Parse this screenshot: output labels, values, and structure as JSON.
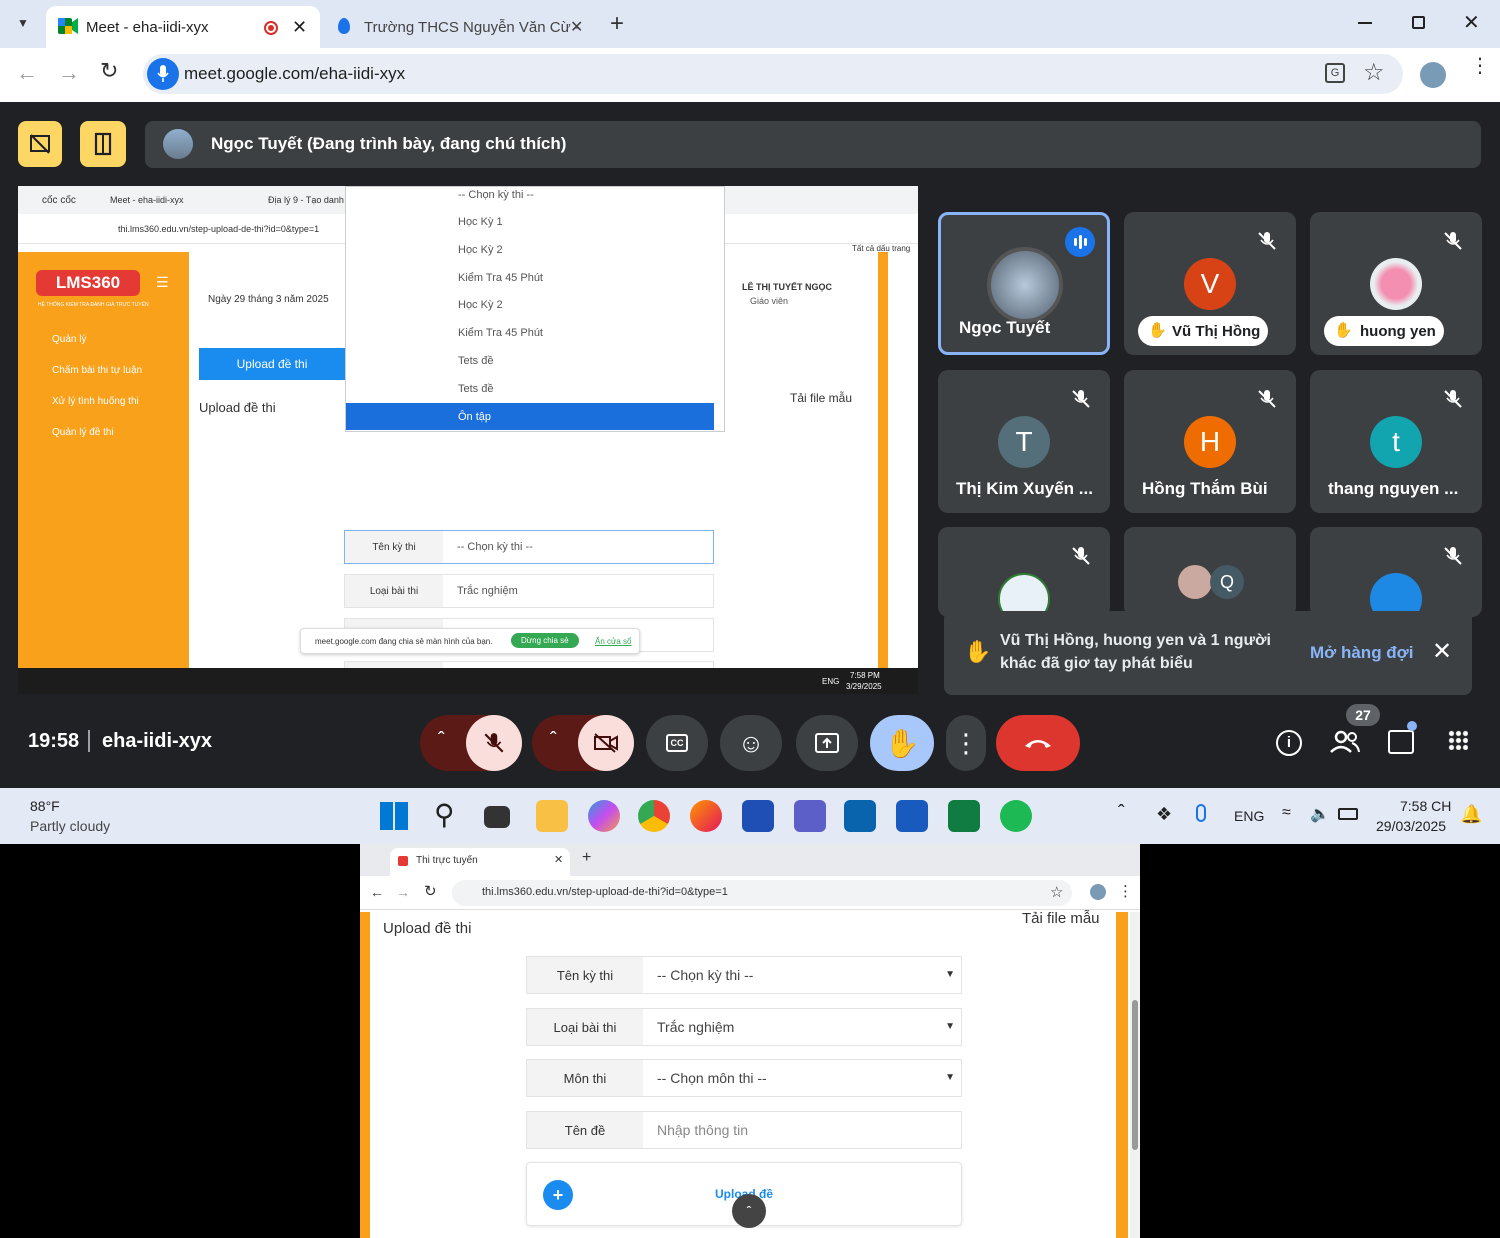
{
  "chrome": {
    "tab1_title": "Meet - eha-iidi-xyx",
    "tab2_title": "Trường THCS Nguyễn Văn Cừ -",
    "url": "meet.google.com/eha-iidi-xyx"
  },
  "meet": {
    "presenter_label": "Ngọc Tuyết (Đang trình bày, đang chú thích)",
    "participants": [
      {
        "name": "Ngọc Tuyết",
        "initial": ""
      },
      {
        "name": "Vũ Thị Hồng",
        "initial": "V"
      },
      {
        "name": "huong yen",
        "initial": ""
      },
      {
        "name": "Thị Kim Xuyến ...",
        "initial": "T"
      },
      {
        "name": "Hồng Thắm Bùi",
        "initial": "H"
      },
      {
        "name": "thang nguyen ...",
        "initial": "t"
      },
      {
        "name": "",
        "initial": ""
      },
      {
        "name": "",
        "initial": "Q"
      },
      {
        "name": "",
        "initial": ""
      }
    ],
    "toast_text": "Vũ Thị Hồng, huong yen và 1 người khác đã giơ tay phát biểu",
    "toast_action": "Mở hàng đợi",
    "time": "19:58",
    "meeting_code": "eha-iidi-xyx",
    "people_count": "27"
  },
  "shared": {
    "browser_tab1": "cốc cốc",
    "browser_tab2": "Meet - eha-iidi-xyx",
    "browser_tab3": "Địa lý 9 - Tạo danh s",
    "url": "thi.lms360.edu.vn/step-upload-de-thi?id=0&type=1",
    "bookmarks": "Tất cả dấu trang",
    "logo": "LMS360",
    "logo_sub": "HỆ THỐNG KIỂM TRA ĐÁNH GIÁ TRỰC TUYẾN",
    "menu": [
      "Quản lý",
      "Chấm bài thi tự luận",
      "Xử lý tình huống thi",
      "Quản lý đề thi"
    ],
    "date": "Ngày 29 tháng 3 năm 2025",
    "user_name": "LÊ THỊ TUYẾT NGỌC",
    "user_role": "Giáo viên",
    "upload_btn": "Upload đề thi",
    "upload_heading": "Upload đề thi",
    "template_link": "Tải file mẫu",
    "dropdown": [
      "-- Chọn kỳ thi --",
      "Học Kỳ 1",
      "Học Kỳ 2",
      "Kiểm Tra 45 Phút",
      "Học Kỳ 2",
      "Kiểm Tra 45 Phút",
      "Tets đề",
      "Tets đề",
      "Ôn tập"
    ],
    "rows": [
      {
        "label": "Tên kỳ thi",
        "value": "-- Chọn kỳ thi --"
      },
      {
        "label": "Loại bài thi",
        "value": "Trắc nghiệm"
      },
      {
        "label": "Môn thi",
        "value": "-- Chọn môn thi --"
      },
      {
        "label": "Tên đề",
        "value": "Nhập thông tin"
      }
    ],
    "share_notice": "meet.google.com đang chia sẻ màn hình của bạn.",
    "stop_share": "Dừng chia sẻ",
    "hide": "Ẩn cửa sổ",
    "tray_lang": "ENG",
    "tray_time": "7:58 PM",
    "tray_date": "3/29/2025"
  },
  "taskbar": {
    "weather_temp": "88°F",
    "weather_desc": "Partly cloudy",
    "lang": "ENG",
    "time": "7:58 CH",
    "date": "29/03/2025"
  },
  "bottom_browser": {
    "tab_title": "Thi trực tuyến",
    "url": "thi.lms360.edu.vn/step-upload-de-thi?id=0&type=1",
    "heading": "Upload đề thi",
    "template_link": "Tải file mẫu",
    "rows": [
      {
        "label": "Tên kỳ thi",
        "value": "-- Chọn kỳ thi --"
      },
      {
        "label": "Loại bài thi",
        "value": "Trắc nghiệm"
      },
      {
        "label": "Môn thi",
        "value": "-- Chọn môn thi --"
      },
      {
        "label": "Tên đề",
        "value": "Nhập thông tin"
      }
    ],
    "upload_label": "Upload đề"
  },
  "colors": {
    "accent": "#1a73e8",
    "orange": "#f9a11b",
    "danger": "#ea4335",
    "meet_bg": "#202124"
  }
}
